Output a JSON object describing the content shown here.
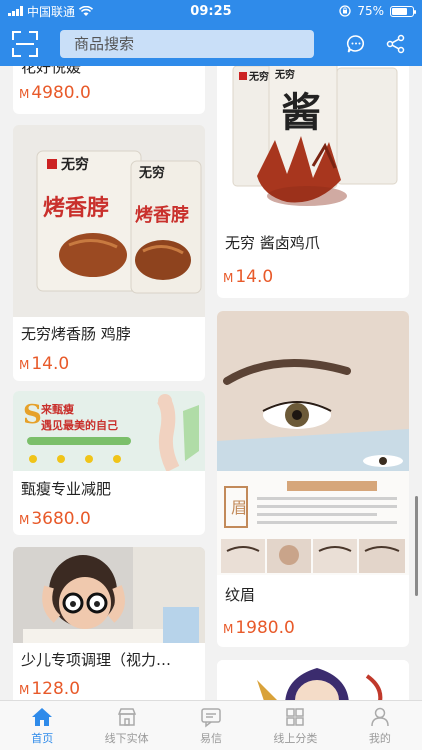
{
  "status_bar": {
    "carrier": "中国联通",
    "time": "09:25",
    "battery": "75%",
    "battery_level": 0.75
  },
  "header": {
    "search_placeholder": "商品搜索",
    "icons": [
      "scan-icon",
      "message-icon",
      "share-icon"
    ]
  },
  "products_left": [
    {
      "title": "花好悦媛",
      "currency": "M",
      "price": "4980.0",
      "image": "banner"
    },
    {
      "title": "无穷烤香肠 鸡脖",
      "currency": "M",
      "price": "14.0",
      "image": "sausage-package",
      "brand_text": "无穷",
      "product_text": "烤香脖"
    },
    {
      "title": "甄瘦专业减肥",
      "currency": "M",
      "price": "3680.0",
      "image": "slimming-banner",
      "banner_line1": "来甄瘦",
      "banner_line2": "遇见最美的自己"
    },
    {
      "title": "少儿专项调理（视力…",
      "currency": "M",
      "price": "128.0",
      "image": "child-glasses"
    }
  ],
  "products_right": [
    {
      "title": "无穷  酱卤鸡爪",
      "currency": "M",
      "price": "14.0",
      "image": "chicken-feet-package",
      "brand_text": "无穷",
      "product_text": "酱"
    },
    {
      "title": "纹眉",
      "currency": "M",
      "price": "1980.0",
      "image": "eyebrow-tattoo",
      "image_text": "眉"
    },
    {
      "title": "",
      "currency": "",
      "price": "",
      "image": "cartoon-illustration"
    }
  ],
  "tabs": [
    {
      "label": "首页",
      "icon": "home-icon",
      "active": true
    },
    {
      "label": "线下实体",
      "icon": "store-icon",
      "active": false
    },
    {
      "label": "易信",
      "icon": "chat-icon",
      "active": false
    },
    {
      "label": "线上分类",
      "icon": "grid-icon",
      "active": false
    },
    {
      "label": "我的",
      "icon": "user-icon",
      "active": false
    }
  ],
  "colors": {
    "primary": "#2f8bea",
    "price": "#e85a2a",
    "tab_inactive": "#9a9a9a"
  }
}
